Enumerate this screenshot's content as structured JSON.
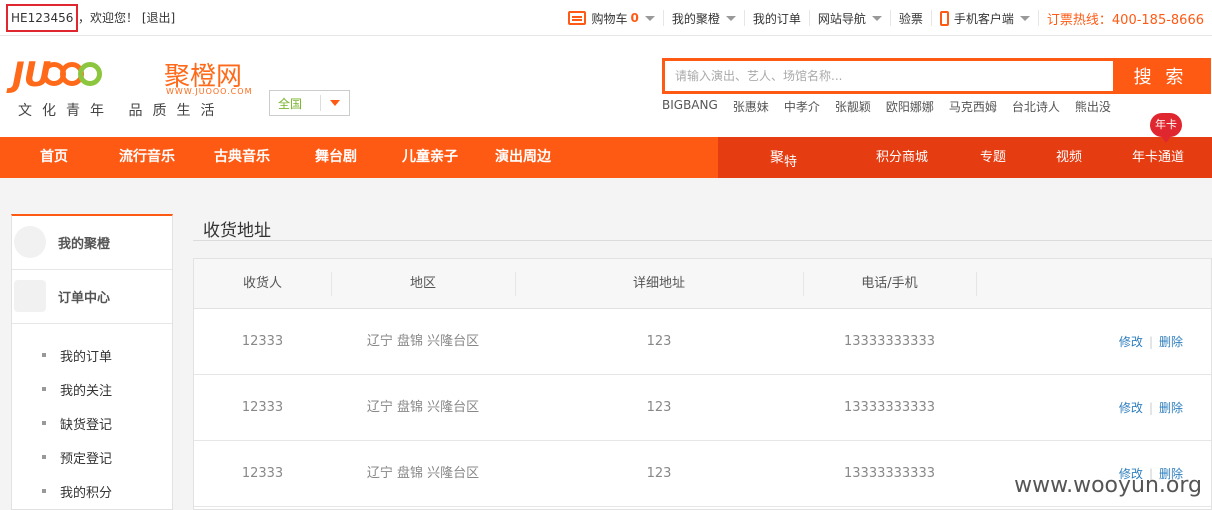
{
  "topbar": {
    "username": "HE123456",
    "welcome": "，欢迎您！",
    "logout": "[退出]",
    "cart_label": "购物车",
    "cart_count": "0",
    "links": [
      "我的聚橙",
      "我的订单",
      "网站导航",
      "验票",
      "手机客户端"
    ],
    "hotline": "订票热线：400-185-8666"
  },
  "logo": {
    "en": "JU",
    "cn": "聚橙网",
    "url": "WWW.JUOOO.COM",
    "slogan": "文化青年 品质生活"
  },
  "city": {
    "selected": "全国"
  },
  "search": {
    "placeholder": "请输入演出、艺人、场馆名称...",
    "button": "搜 索",
    "hotwords": [
      "BIGBANG",
      "张惠妹",
      "中孝介",
      "张靓颖",
      "欧阳娜娜",
      "马克西姆",
      "台北诗人",
      "熊出没"
    ]
  },
  "nav": {
    "items": [
      "首页",
      "流行音乐",
      "古典音乐",
      "舞台剧",
      "儿童亲子",
      "演出周边"
    ],
    "right_items": [
      "积分商城",
      "专题",
      "视频",
      "年卡通道"
    ],
    "jute_main": "聚",
    "jute_sub": "特",
    "badge": "年卡"
  },
  "sidebar": {
    "sections": [
      "我的聚橙",
      "订单中心"
    ],
    "items": [
      "我的订单",
      "我的关注",
      "缺货登记",
      "预定登记",
      "我的积分"
    ]
  },
  "main": {
    "title": "收货地址",
    "columns": [
      "收货人",
      "地区",
      "详细地址",
      "电话/手机"
    ],
    "rows": [
      {
        "name": "12333",
        "region": "辽宁 盘锦 兴隆台区",
        "address": "123",
        "phone": "13333333333"
      },
      {
        "name": "12333",
        "region": "辽宁 盘锦 兴隆台区",
        "address": "123",
        "phone": "13333333333"
      },
      {
        "name": "12333",
        "region": "辽宁 盘锦 兴隆台区",
        "address": "123",
        "phone": "13333333333"
      }
    ],
    "edit": "修改",
    "delete": "删除"
  },
  "watermark": "www.wooyun.org",
  "colors": {
    "accent": "#ff5a14",
    "nav_right": "#e63c12",
    "highlight_box": "#e0262e",
    "link": "#2f7fbf"
  }
}
